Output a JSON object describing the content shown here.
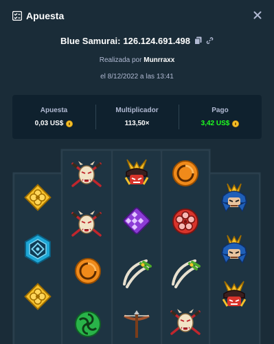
{
  "header": {
    "title": "Apuesta",
    "logo_icon": "bet-slip-icon",
    "close_icon": "close-icon"
  },
  "bet": {
    "game": "Blue Samurai:",
    "id": "126.124.691.498",
    "copy_icon": "copy-icon",
    "link_icon": "link-icon"
  },
  "placed": {
    "prefix": "Realizada por",
    "user": "Munrraxx"
  },
  "date": "el 8/12/2022 a las 13:41",
  "stats": {
    "bet_label": "Apuesta",
    "bet_value": "0,03 US$",
    "multiplier_label": "Multiplicador",
    "multiplier_value": "113,50×",
    "payout_label": "Pago",
    "payout_value": "3,42 US$",
    "currency_icon": "coin-icon"
  },
  "colors": {
    "background": "#1a2c38",
    "panel": "#0f212e",
    "muted_text": "#b1bad3",
    "win_green": "#1fff20",
    "coin_gold": "#f5c02a"
  },
  "reels": [
    [
      "gold-flower-icon",
      "blue-hex-crest-icon",
      "gold-flower-icon"
    ],
    [
      "oni-mask-icon",
      "oni-mask-icon",
      "orange-tomoe-icon",
      "green-tomoe-icon"
    ],
    [
      "samurai-helmet-icon",
      "purple-diamond-crest-icon",
      "crossed-swords-icon",
      "crossbow-icon"
    ],
    [
      "orange-tomoe-icon",
      "red-plum-crest-icon",
      "crossed-swords-icon",
      "oni-mask-icon"
    ],
    [
      "blue-samurai-icon",
      "blue-samurai-icon",
      "samurai-helmet-icon"
    ]
  ]
}
